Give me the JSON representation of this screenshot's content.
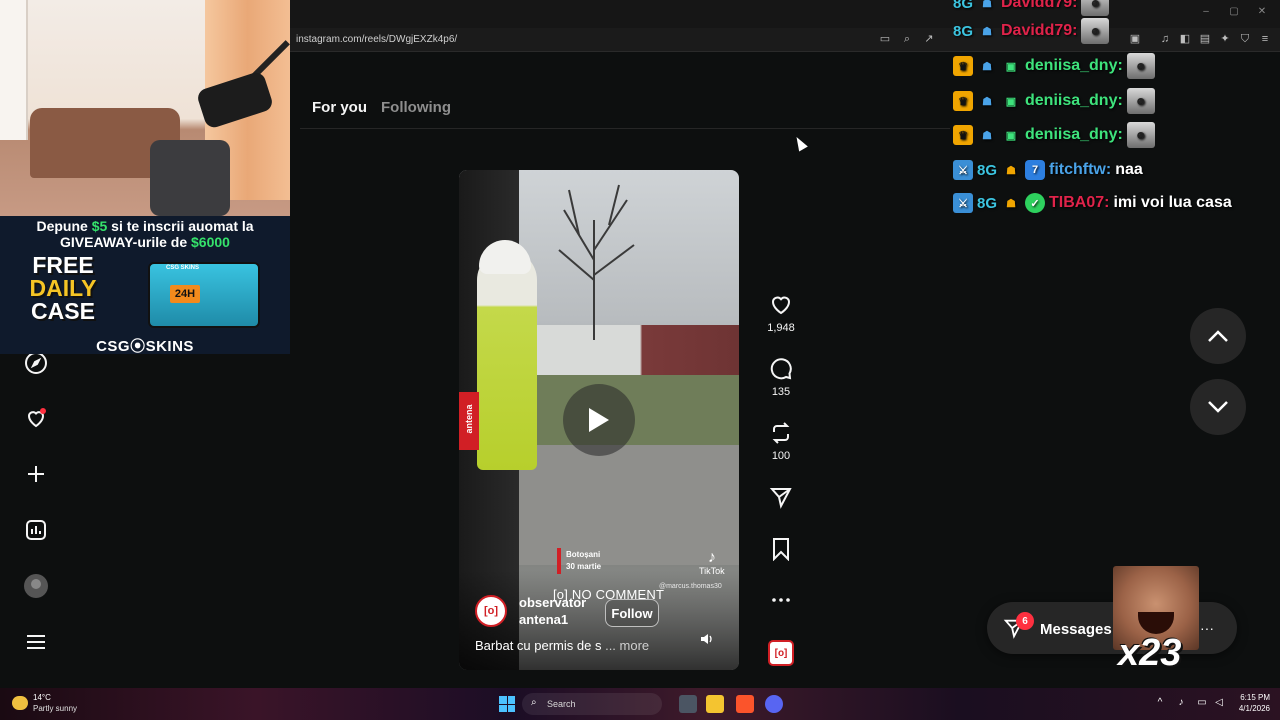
{
  "browser": {
    "url": "instagram.com/reels/DWgjEXZk4p6/"
  },
  "feed_tabs": {
    "for_you": "For you",
    "following": "Following"
  },
  "left_nav": {
    "icons": [
      "explore-icon",
      "notifications-heart-icon",
      "create-plus-icon",
      "dashboard-icon",
      "profile-avatar",
      "menu-icon"
    ]
  },
  "reel": {
    "overlay_tag": "antena",
    "location_city": "Botoșani",
    "location_date": "30 martie",
    "watermark": "TikTok",
    "watermark_user": "@marcus.thomas30",
    "segment_title": "[o] NO COMMENT",
    "author_line1": "observator",
    "author_line2": "antena1",
    "author_avatar_text": "[o]",
    "follow_label": "Follow",
    "caption": "Barbat cu permis de s",
    "caption_more": "... more"
  },
  "actions": {
    "likes": "1,948",
    "comments": "135",
    "reposts": "100",
    "audio_text": "[o]"
  },
  "messages": {
    "label": "Messages",
    "badge": "6",
    "more": "···"
  },
  "chat": {
    "lines": [
      {
        "user": "Davidd79:",
        "user_color": "#e0234a",
        "text": ""
      },
      {
        "user": "deniisa_dny:",
        "user_color": "#3ee37c",
        "text": ""
      },
      {
        "user": "deniisa_dny:",
        "user_color": "#3ee37c",
        "text": ""
      },
      {
        "user": "deniisa_dny:",
        "user_color": "#3ee37c",
        "text": ""
      },
      {
        "user": "fitchftw:",
        "user_color": "#4aa3e8",
        "text": "naa"
      },
      {
        "user": "TIBA07:",
        "user_color": "#e0234a",
        "text": "imi voi lua casa"
      }
    ]
  },
  "ad": {
    "line1_a": "Depune",
    "line1_amount": "$5",
    "line1_b": "si te inscrii auomat la",
    "line2_a": "GIVEAWAY-urile de",
    "line2_amount": "$6000",
    "free": "FREE",
    "daily": "DAILY",
    "case": "CASE",
    "case_tag": "24H",
    "case_label": "CSG SKINS",
    "brand": "CSG⦿SKINS"
  },
  "meme": {
    "count": "x23"
  },
  "taskbar": {
    "weather_temp": "14°C",
    "weather_desc": "Partly sunny",
    "search": "Search",
    "time": "6:15 PM",
    "date": "4/1/2026"
  },
  "colors": {
    "ig_bg": "#0d0f0f",
    "accent_red": "#d11f25",
    "badge_red": "#ff3040",
    "chat_green": "#3ee37c"
  }
}
